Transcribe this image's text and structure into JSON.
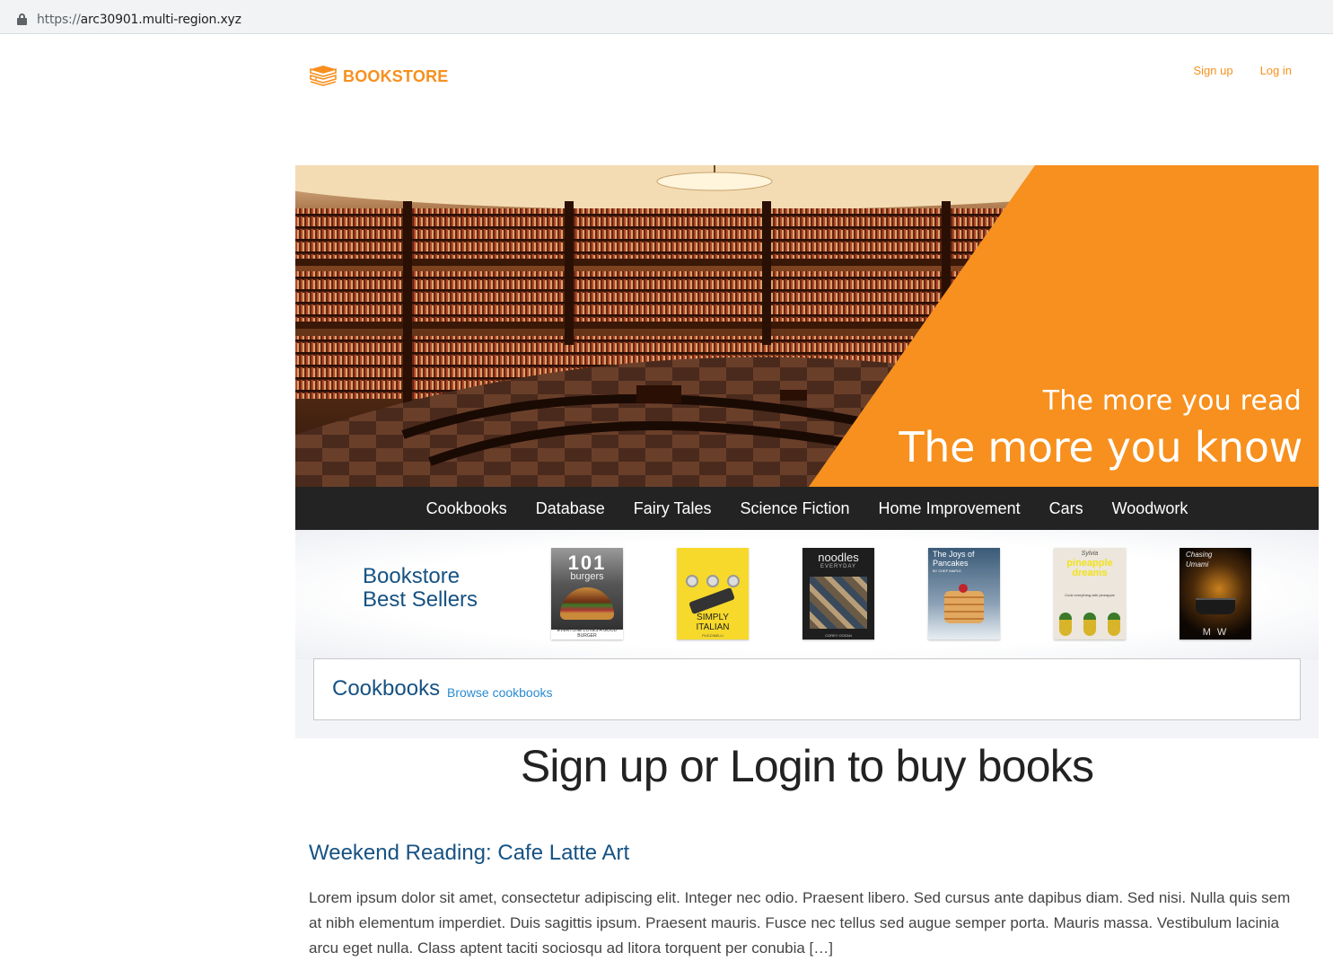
{
  "browser": {
    "url_scheme": "https://",
    "url_host": "arc30901.multi-region.xyz"
  },
  "header": {
    "brand": "BOOKSTORE",
    "logo_icon": "books-stack-icon",
    "signup_label": "Sign up",
    "login_label": "Log in"
  },
  "hero": {
    "tagline_small": "The more you read",
    "tagline_large": "The more you know",
    "accent_color": "#f7901e"
  },
  "nav": {
    "items": [
      "Cookbooks",
      "Database",
      "Fairy Tales",
      "Science Fiction",
      "Home Improvement",
      "Cars",
      "Woodwork"
    ]
  },
  "best_sellers": {
    "title_line1": "Bookstore",
    "title_line2": "Best Sellers",
    "books": [
      {
        "cover_title": "101",
        "cover_subtitle": "burgers",
        "cover_footer": "EVERYONE LOVES A GOOD BURGER"
      },
      {
        "cover_title": "SIMPLY",
        "cover_subtitle": "ITALIAN",
        "cover_footer": "PUCCINELLI"
      },
      {
        "cover_title": "noodles",
        "cover_subtitle": "EVERYDAY",
        "cover_footer": "COREY OCEAN"
      },
      {
        "cover_title": "The Joys of",
        "cover_subtitle": "Pancakes",
        "cover_footer": "BY CHEF MAPLE"
      },
      {
        "cover_title": "Sylvia",
        "cover_subtitle": "pineapple dreams",
        "cover_footer": "Cook everything with pineapple"
      },
      {
        "cover_title": "Chasing",
        "cover_subtitle": "Umami",
        "cover_footer": "M W"
      }
    ]
  },
  "cookbooks_panel": {
    "heading": "Cookbooks",
    "link": "Browse cookbooks"
  },
  "signup_banner": "Sign up or Login to buy books",
  "post": {
    "title": "Weekend Reading: Cafe Latte Art",
    "excerpt": "Lorem ipsum dolor sit amet, consectetur adipiscing elit. Integer nec odio. Praesent libero. Sed cursus ante dapibus diam. Sed nisi. Nulla quis sem at nibh elementum imperdiet. Duis sagittis ipsum. Praesent mauris. Fusce nec tellus sed augue semper porta. Mauris massa. Vestibulum lacinia arcu eget nulla. Class aptent taciti sociosqu ad litora torquent per conubia […]"
  }
}
